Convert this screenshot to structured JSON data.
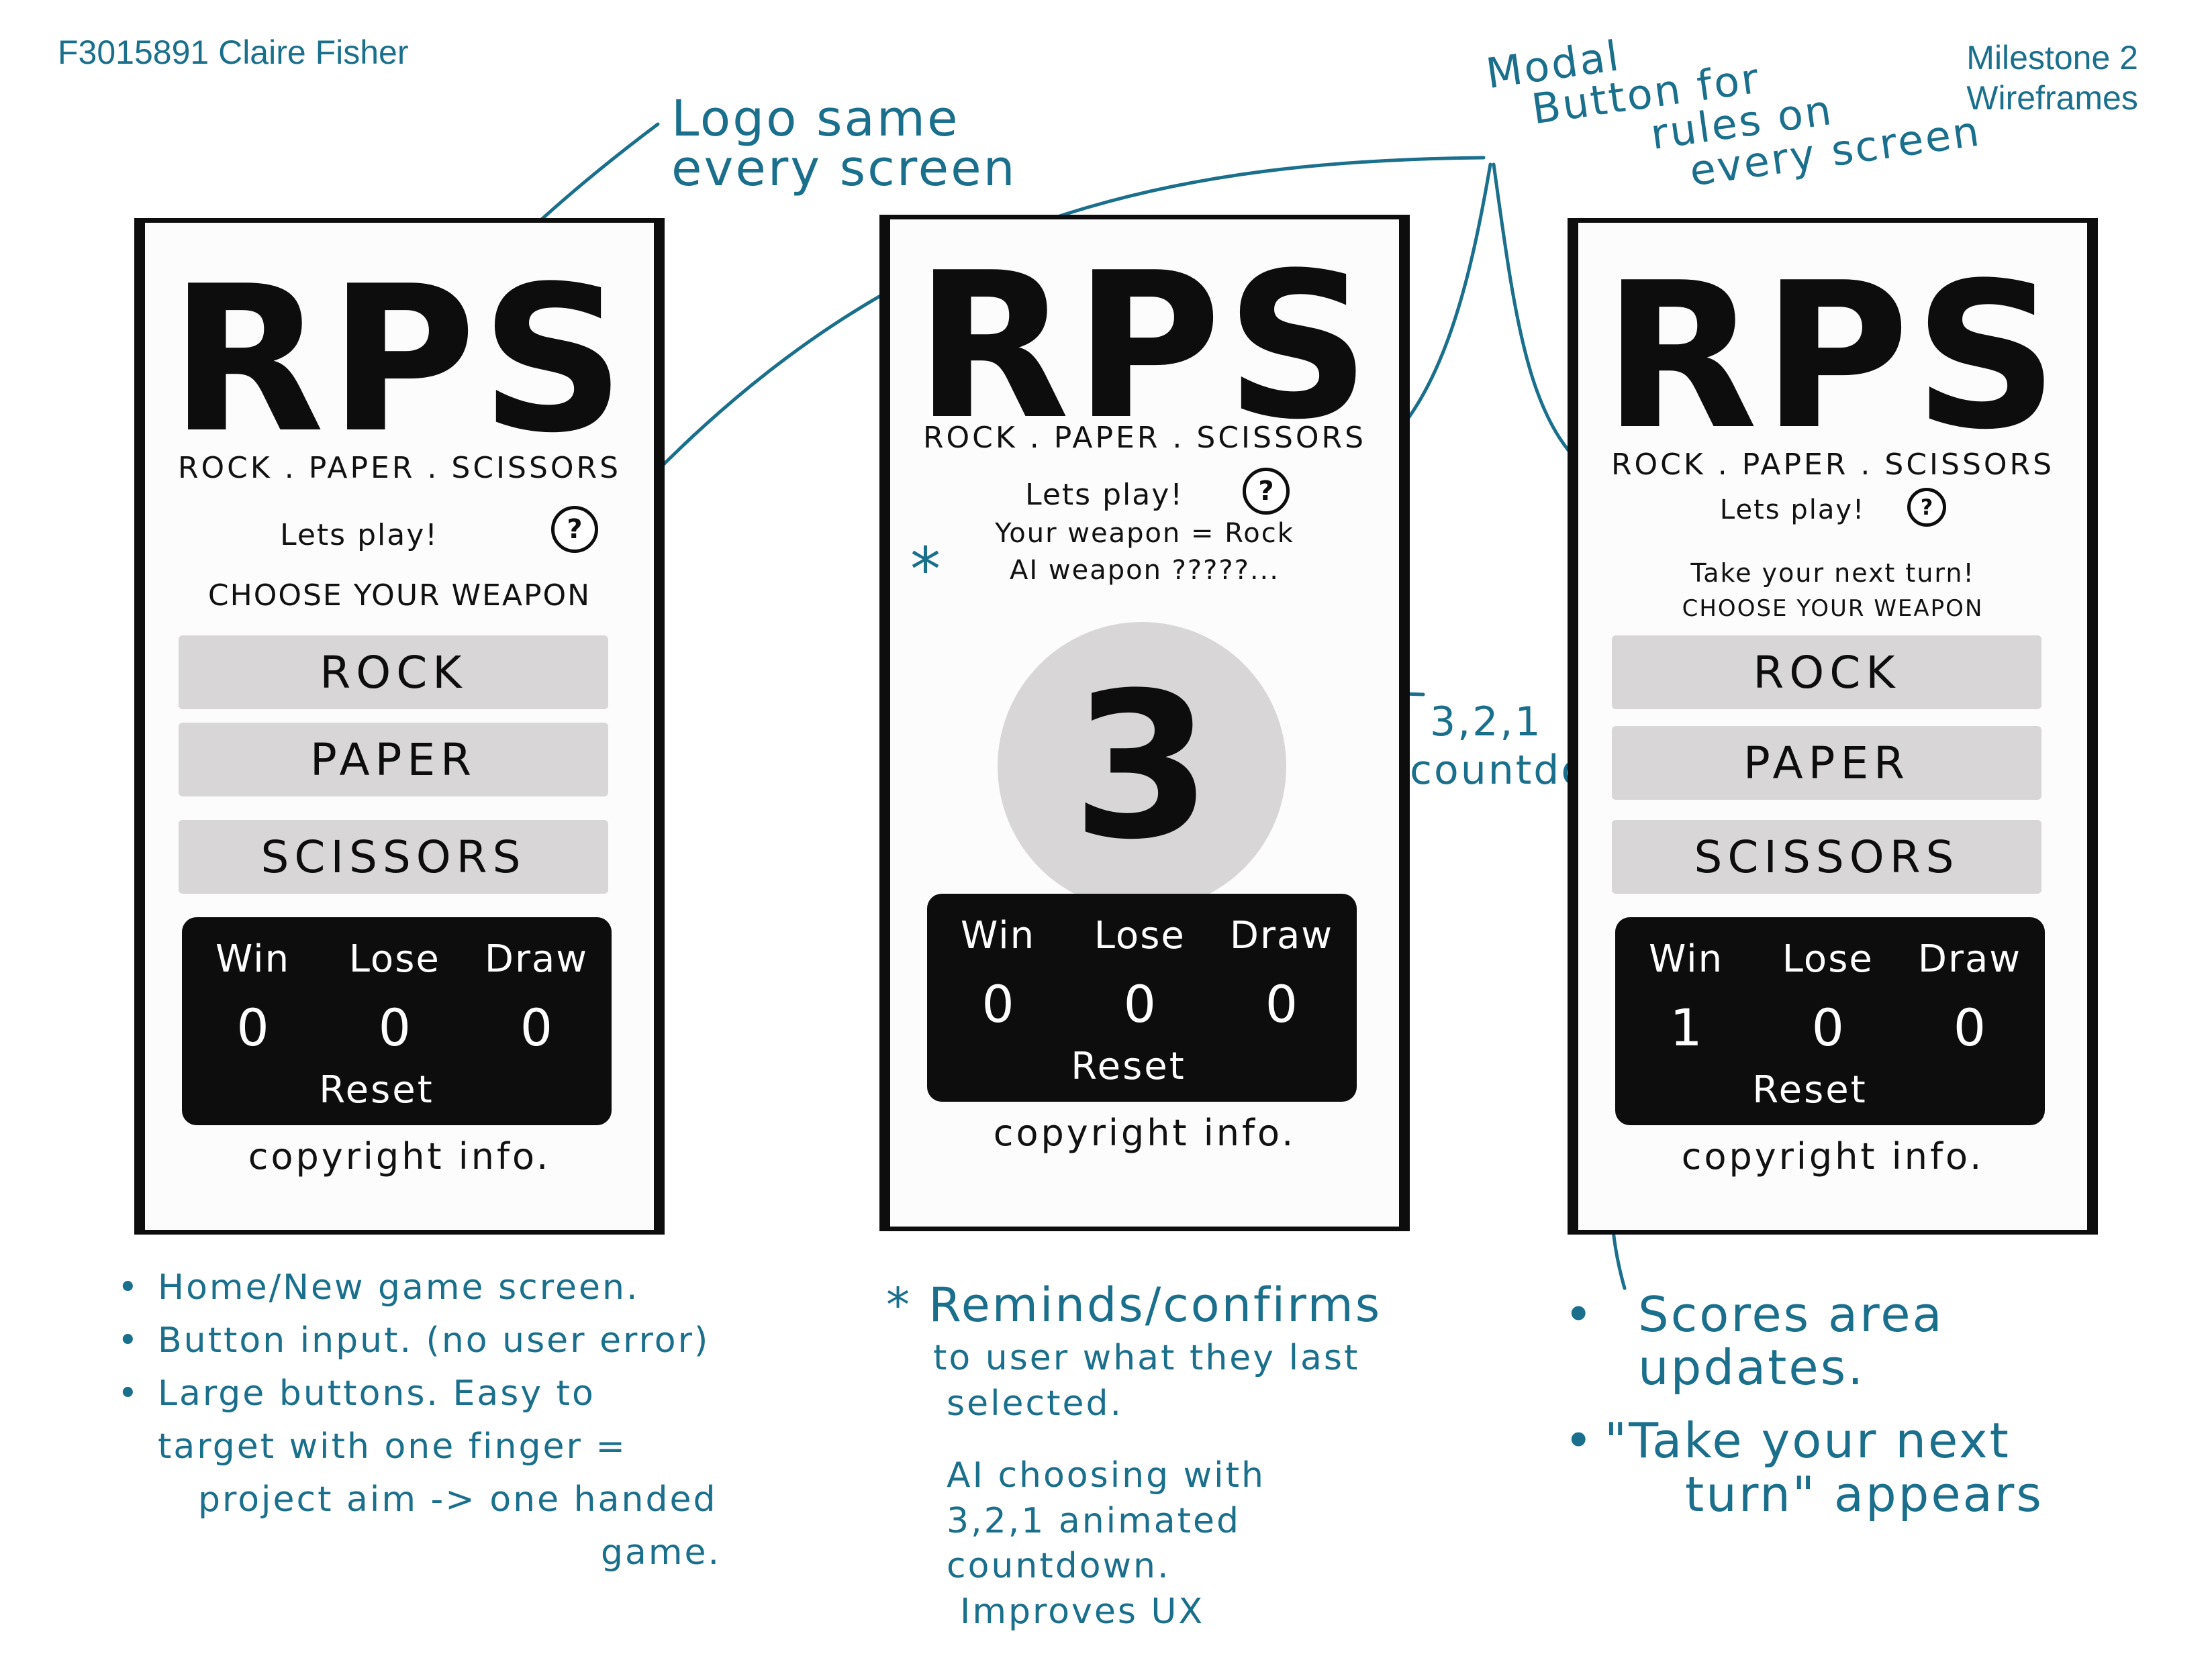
{
  "header": {
    "author": "F3015891 Claire Fisher",
    "milestone_line1": "Milestone 2",
    "milestone_line2": "Wireframes"
  },
  "annotations": {
    "logo_note_line1": "Logo same",
    "logo_note_line2": "every screen",
    "modal_note_line1": "Modal",
    "modal_note_line2": "Button for",
    "modal_note_line3": "rules on",
    "modal_note_line4": "every screen",
    "countdown_note_line1": "3,2,1",
    "countdown_note_line2": "countdown"
  },
  "screen_home": {
    "logo": "RPS",
    "subtitle": "ROCK . PAPER . SCISSORS",
    "lets_play": "Lets play!",
    "help_icon": "?",
    "prompt": "CHOOSE YOUR WEAPON",
    "buttons": [
      "ROCK",
      "PAPER",
      "SCISSORS"
    ],
    "scores": {
      "labels": [
        "Win",
        "Lose",
        "Draw"
      ],
      "values": [
        "0",
        "0",
        "0"
      ],
      "reset": "Reset"
    },
    "copyright": "copyright info."
  },
  "screen_countdown": {
    "logo": "RPS",
    "subtitle": "ROCK . PAPER . SCISSORS",
    "lets_play": "Lets play!",
    "help_icon": "?",
    "your_weapon": "Your weapon = Rock",
    "ai_weapon": "AI weapon ?????...",
    "asterisk": "*",
    "countdown": "3",
    "scores": {
      "labels": [
        "Win",
        "Lose",
        "Draw"
      ],
      "values": [
        "0",
        "0",
        "0"
      ],
      "reset": "Reset"
    },
    "copyright": "copyright info."
  },
  "screen_next_turn": {
    "logo": "RPS",
    "subtitle": "ROCK . PAPER . SCISSORS",
    "lets_play": "Lets play!",
    "help_icon": "?",
    "next_turn": "Take your next turn!",
    "prompt": "CHOOSE YOUR WEAPON",
    "buttons": [
      "ROCK",
      "PAPER",
      "SCISSORS"
    ],
    "scores": {
      "labels": [
        "Win",
        "Lose",
        "Draw"
      ],
      "values": [
        "1",
        "0",
        "0"
      ],
      "reset": "Reset"
    },
    "copyright": "copyright info."
  },
  "notes_left": {
    "line1": "Home/New game screen.",
    "line2": "Button input. (no user error)",
    "line3": "Large buttons. Easy to",
    "line4": "target with one finger =",
    "line5": "project aim -> one handed",
    "line6": "game."
  },
  "notes_middle": {
    "line1": "* Reminds/confirms",
    "line2": "to user what they last",
    "line3": "selected.",
    "line4": "AI choosing with",
    "line5": "3,2,1 animated",
    "line6": "countdown.",
    "line7": "Improves UX"
  },
  "notes_right": {
    "line1": "Scores area",
    "line2": "updates.",
    "line3": "\"Take your next",
    "line4": "turn\" appears"
  },
  "colors": {
    "ink": "#111111",
    "annotation": "#1a6f8c",
    "button_grey": "#d8d6d6",
    "score_panel": "#0d0d0d"
  }
}
